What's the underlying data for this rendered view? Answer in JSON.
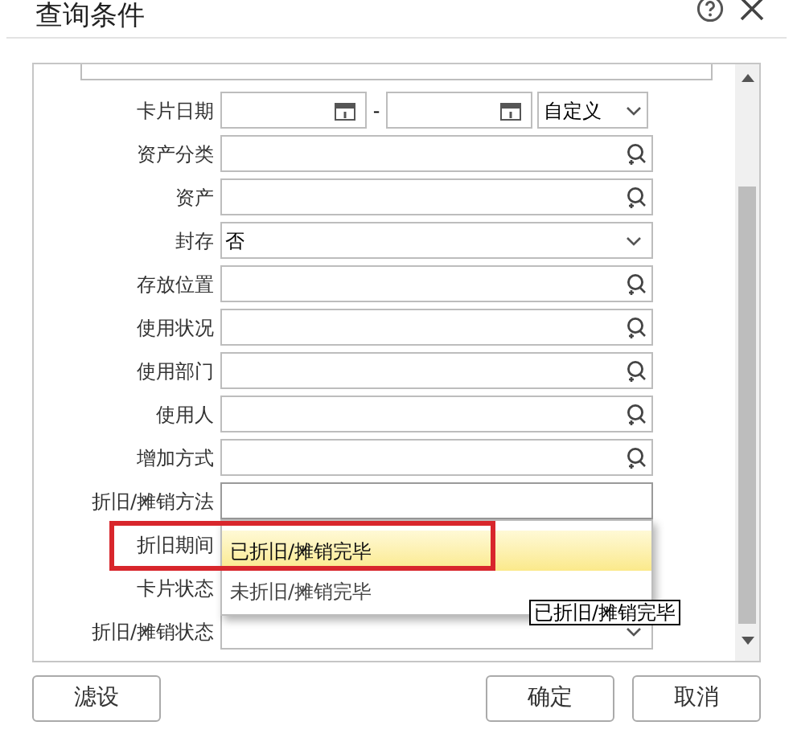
{
  "dialog": {
    "title": "查询条件"
  },
  "fields": [
    {
      "label": "卡片日期",
      "kind": "date-range",
      "separator": "-",
      "preset": "自定义"
    },
    {
      "label": "资产分类",
      "kind": "lookup"
    },
    {
      "label": "资产",
      "kind": "lookup"
    },
    {
      "label": "封存",
      "kind": "select",
      "value": "否"
    },
    {
      "label": "存放位置",
      "kind": "lookup"
    },
    {
      "label": "使用状况",
      "kind": "lookup"
    },
    {
      "label": "使用部门",
      "kind": "lookup"
    },
    {
      "label": "使用人",
      "kind": "lookup"
    },
    {
      "label": "增加方式",
      "kind": "lookup"
    },
    {
      "label": "折旧/摊销方法",
      "kind": "text",
      "open": true
    },
    {
      "label": "折旧期间",
      "kind": "covered",
      "highlighted": true
    },
    {
      "label": "卡片状态",
      "kind": "covered"
    },
    {
      "label": "折旧/摊销状态",
      "kind": "select"
    }
  ],
  "dropdown": {
    "options": [
      {
        "label": "已折旧/摊销完毕",
        "selected": true
      },
      {
        "label": "未折旧/摊销完毕",
        "selected": false
      }
    ],
    "tooltip": "已折旧/摊销完毕"
  },
  "buttons": [
    "滤设",
    "确定",
    "取消"
  ]
}
